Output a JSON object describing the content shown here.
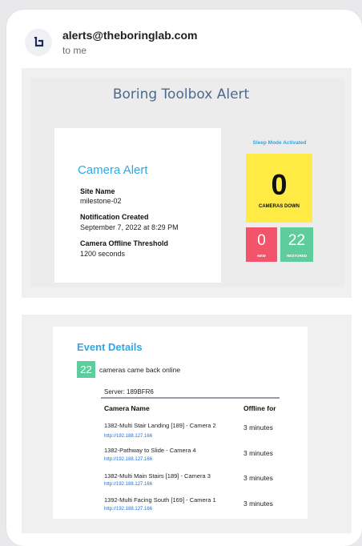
{
  "email": {
    "sender": "alerts@theboringlab.com",
    "recipient": "to me",
    "avatar_icon": "boring-lab-logo-icon"
  },
  "alert": {
    "title": "Boring Toolbox Alert",
    "section_title": "Camera Alert",
    "fields": [
      {
        "label": "Site Name",
        "value": "milestone-02"
      },
      {
        "label": "Notification Created",
        "value": "September 7, 2022 at 8:29 PM"
      },
      {
        "label": "Camera Offline Threshold",
        "value": "1200 seconds"
      }
    ],
    "sleep_mode": "Sleep Mode Activated",
    "cameras_down": {
      "count": "0",
      "label": "CAMERAS DOWN",
      "color": "#ffeb44"
    },
    "new": {
      "count": "0",
      "label": "NEW",
      "color": "#f2546c"
    },
    "restored": {
      "count": "22",
      "label": "RESTORED",
      "color": "#5fcc9e"
    }
  },
  "event": {
    "title": "Event Details",
    "back_count": "22",
    "back_text": "cameras came back online",
    "server": "Server: 189BFR6",
    "columns": [
      "Camera Name",
      "Offline for"
    ],
    "rows": [
      {
        "name": "1382-Multi Stair Landing [189] - Camera 2",
        "link": "http://192.188.127.166",
        "offline": "3 minutes"
      },
      {
        "name": "1382-Pathway to Slide - Camera 4",
        "link": "http://192.188.127.166",
        "offline": "3 minutes"
      },
      {
        "name": "1382-Multi Main Stairs [189] - Camera 3",
        "link": "http://192.188.127.166",
        "offline": "3 minutes"
      },
      {
        "name": "1392-Multi Facing South [169] - Camera 1",
        "link": "http://192.188.127.166",
        "offline": "3 minutes"
      }
    ]
  }
}
